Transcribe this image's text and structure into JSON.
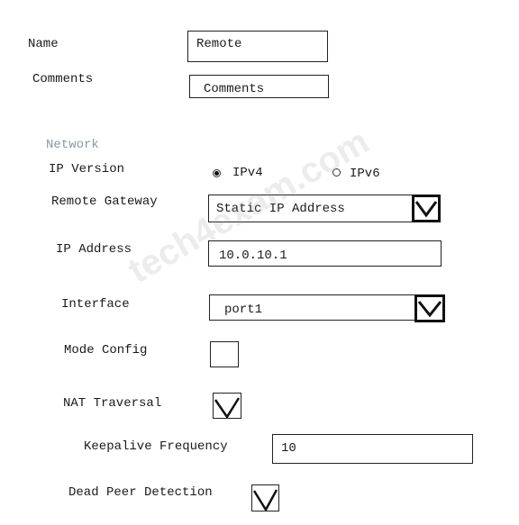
{
  "form": {
    "name": {
      "label": "Name",
      "value": "Remote"
    },
    "comments": {
      "label": "Comments",
      "placeholder": "Comments"
    },
    "network_section": "Network",
    "ip_version": {
      "label": "IP Version",
      "options": [
        {
          "label": "IPv4",
          "selected": true
        },
        {
          "label": "IPv6",
          "selected": false
        }
      ]
    },
    "remote_gateway": {
      "label": "Remote Gateway",
      "value": "Static IP Address"
    },
    "ip_address": {
      "label": "IP Address",
      "value": "10.0.10.1"
    },
    "interface": {
      "label": "Interface",
      "value": "port1"
    },
    "mode_config": {
      "label": "Mode Config",
      "checked": false
    },
    "nat_traversal": {
      "label": "NAT Traversal",
      "checked": true
    },
    "keepalive_frequency": {
      "label": "Keepalive Frequency",
      "value": "10"
    },
    "dead_peer_detection": {
      "label": "Dead Peer Detection",
      "checked": true
    }
  },
  "watermark": "tech4exam.com",
  "icons": {
    "dropdown": "chevron-down-icon",
    "checkmark": "checkmark-icon"
  }
}
